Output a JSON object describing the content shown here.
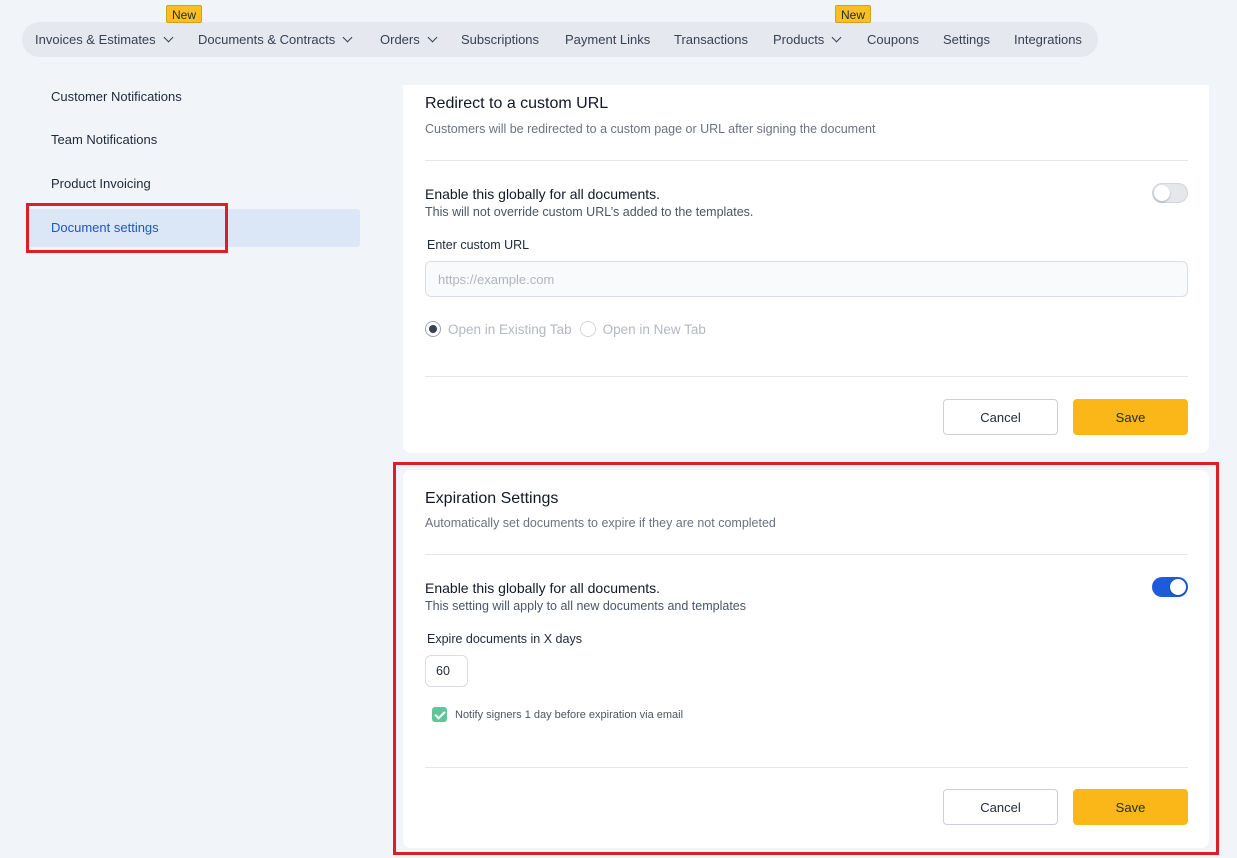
{
  "nav": {
    "items": [
      {
        "label": "Invoices & Estimates",
        "dropdown": true,
        "badge": "New"
      },
      {
        "label": "Documents & Contracts",
        "dropdown": true
      },
      {
        "label": "Orders",
        "dropdown": true
      },
      {
        "label": "Subscriptions"
      },
      {
        "label": "Payment Links"
      },
      {
        "label": "Transactions"
      },
      {
        "label": "Products",
        "dropdown": true,
        "badge": "New"
      },
      {
        "label": "Coupons"
      },
      {
        "label": "Settings"
      },
      {
        "label": "Integrations"
      }
    ]
  },
  "sidebar": {
    "items": [
      {
        "label": "Customer Notifications"
      },
      {
        "label": "Team Notifications"
      },
      {
        "label": "Product Invoicing"
      },
      {
        "label": "Document settings",
        "active": true
      }
    ]
  },
  "redirect": {
    "title": "Redirect to a custom URL",
    "description": "Customers will be redirected to a custom page or URL after signing the document",
    "enable_label": "Enable this globally for all documents.",
    "enable_sub": "This will not override custom URL’s added to the templates.",
    "toggle_on": false,
    "url_label": "Enter custom URL",
    "url_value": "",
    "url_placeholder": "https://example.com",
    "open_existing": "Open in Existing Tab",
    "open_new": "Open in New Tab",
    "cancel": "Cancel",
    "save": "Save"
  },
  "expiration": {
    "title": "Expiration Settings",
    "description": "Automatically set documents to expire if they are not completed",
    "enable_label": "Enable this globally for all documents.",
    "enable_sub": "This setting will apply to all new documents and templates",
    "toggle_on": true,
    "days_label": "Expire documents in X days",
    "days_value": "60",
    "notify_label": "Notify signers 1 day before expiration via email",
    "notify_checked": true,
    "cancel": "Cancel",
    "save": "Save"
  },
  "colors": {
    "accent": "#1d5bd8",
    "save_button": "#fbb717",
    "highlight_box": "#dc1f26",
    "new_badge": "#fbbf24",
    "checkbox": "#5fc59a"
  }
}
